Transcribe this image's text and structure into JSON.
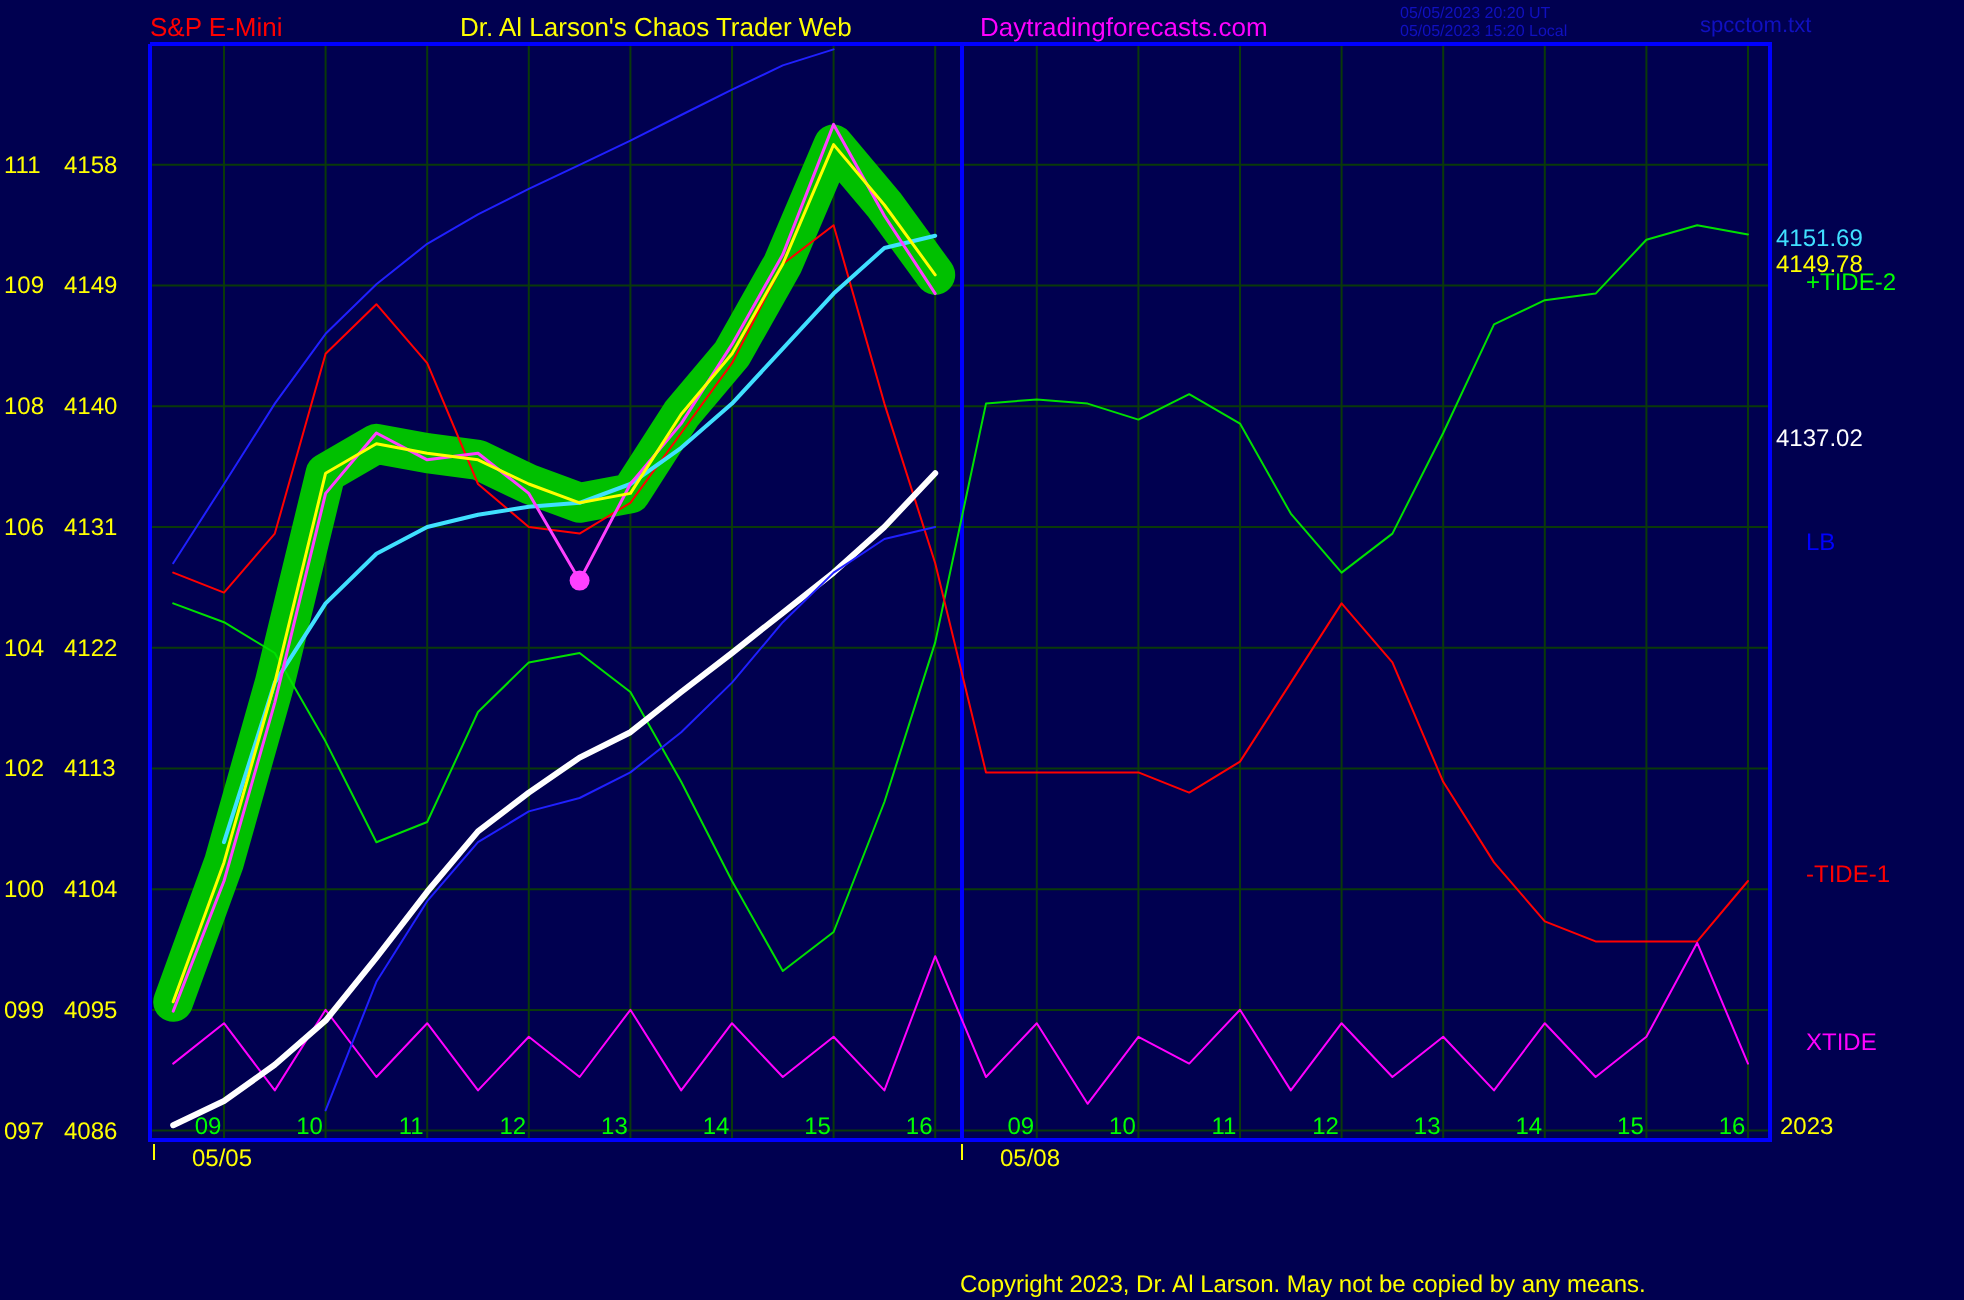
{
  "header": {
    "symbol": "S&P E-Mini",
    "title": "Dr. Al Larson's Chaos Trader Web",
    "site": "Daytradingforecasts.com",
    "time_ut": "05/05/2023 20:20 UT",
    "time_local": "05/05/2023 15:20 Local",
    "file": "spcctom.txt"
  },
  "scale_labels": [
    "111",
    "109",
    "108",
    "106",
    "104",
    "102",
    "100",
    "099",
    "097"
  ],
  "dates": [
    "05/05",
    "05/08"
  ],
  "year": "2023",
  "right_labels": [
    {
      "text": "4151.69",
      "color": "#40e0ff"
    },
    {
      "text": "4149.78",
      "color": "#ffff00"
    },
    {
      "text": "+TIDE-2",
      "color": "#00ff00"
    },
    {
      "text": "4137.02",
      "color": "#ffffff"
    },
    {
      "text": "LB",
      "color": "#0000ff"
    },
    {
      "text": "-TIDE-1",
      "color": "#ff0000"
    },
    {
      "text": "XTIDE",
      "color": "#ff00ff"
    }
  ],
  "chart_data": {
    "type": "line",
    "categories": [
      null,
      "09",
      null,
      "10",
      null,
      "11",
      null,
      "12",
      null,
      "13",
      null,
      "14",
      null,
      "15",
      null,
      "16",
      null,
      "09",
      null,
      "10",
      null,
      "11",
      null,
      "12",
      null,
      "13",
      null,
      "14",
      null,
      "15",
      null,
      "16"
    ],
    "yticks": [
      {
        "value": 4158,
        "label": "4158"
      },
      {
        "value": 4149,
        "label": "4149"
      },
      {
        "value": 4140,
        "label": "4140"
      },
      {
        "value": 4131,
        "label": "4131"
      },
      {
        "value": 4122,
        "label": "4122"
      },
      {
        "value": 4113,
        "label": "4113"
      },
      {
        "value": 4104,
        "label": "4104"
      },
      {
        "value": 4095,
        "label": "4095"
      },
      {
        "value": 4086,
        "label": "4086"
      }
    ],
    "ylim": [
      4085.3,
      4167
    ],
    "grid": true,
    "series": [
      {
        "color": "#00c000",
        "values": [
          4095.6,
          4106,
          4119.4,
          4135,
          4137.2,
          4136.5,
          4136,
          4134.2,
          4132.8,
          4133.5,
          4139.4,
          4143.9,
          4150.6,
          4159.5,
          4155,
          4149.8,
          null,
          null,
          null,
          null,
          null,
          null,
          null,
          null,
          null,
          null,
          null,
          null,
          null,
          null,
          null,
          null
        ]
      },
      {
        "color": "#2020ff",
        "values": [
          4128.3,
          4134.2,
          4140.2,
          4145.4,
          4149.1,
          4152.1,
          4154.3,
          4156.2,
          4158,
          4159.8,
          4161.7,
          4163.6,
          4165.4,
          4166.6,
          null,
          null,
          null,
          null,
          null,
          null,
          null,
          null,
          null,
          null,
          null,
          null,
          null,
          null,
          null,
          null,
          null,
          null
        ]
      },
      {
        "color": "#2020ff",
        "values": [
          null,
          null,
          null,
          4087.5,
          4097.1,
          4103.1,
          4107.5,
          4109.8,
          4110.8,
          4112.7,
          4115.7,
          4119.4,
          4123.9,
          4127.6,
          4130.1,
          4131,
          null,
          null,
          null,
          null,
          null,
          null,
          null,
          null,
          null,
          null,
          null,
          null,
          null,
          null,
          null,
          null
        ]
      },
      {
        "color": "#00e000",
        "values": [
          4125.3,
          4123.9,
          4121.6,
          4115,
          4107.5,
          4109,
          4117.2,
          4120.9,
          4121.6,
          4118.7,
          4112,
          4104.6,
          4097.9,
          4100.8,
          4110.5,
          4122.4,
          4140.2,
          4140.5,
          4140.2,
          4139,
          4140.9,
          4138.7,
          4132,
          4127.6,
          4130.5,
          4138,
          4146.1,
          4147.9,
          4148.4,
          4152.4,
          4153.5,
          4152.8
        ]
      },
      {
        "color": "#ff0000",
        "values": [
          4127.6,
          4126.1,
          4130.5,
          4143.9,
          4147.6,
          4143.2,
          4134.2,
          4131,
          4130.5,
          4132.8,
          4138,
          4143.2,
          4150.6,
          4153.5,
          4140.2,
          4128.3,
          4112.7,
          4112.7,
          4112.7,
          4112.7,
          4111.2,
          4113.5,
          4119.4,
          4125.3,
          4120.9,
          4112,
          4106,
          4101.6,
          4100.1,
          4100.1,
          4100.1,
          4104.6
        ]
      },
      {
        "color": "#ff00ff",
        "values": [
          4091,
          4094,
          4089,
          4095,
          4090,
          4094,
          4089,
          4093,
          4090,
          4095,
          4089,
          4094,
          4090,
          4093,
          4089,
          4099,
          4090,
          4094,
          4088,
          4093,
          4091,
          4095,
          4089,
          4094,
          4090,
          4093,
          4089,
          4094,
          4090,
          4093,
          4100,
          4091
        ]
      },
      {
        "color": "#ffffff",
        "values": [
          4086.4,
          4088.2,
          4090.9,
          4094.2,
          4098.9,
          4103.8,
          4108.3,
          4111.2,
          4113.8,
          4115.7,
          4118.7,
          4121.6,
          4124.6,
          4127.6,
          4131,
          4135,
          null,
          null,
          null,
          null,
          null,
          null,
          null,
          null,
          null,
          null,
          null,
          null,
          null,
          null,
          null,
          null
        ]
      },
      {
        "color": "#40e0ff",
        "values": [
          null,
          4107.5,
          4119.4,
          4125.3,
          4129,
          4131,
          4131.9,
          4132.5,
          4132.8,
          4134.2,
          4136.9,
          4140.2,
          4144.3,
          4148.4,
          4151.8,
          4152.7,
          null,
          null,
          null,
          null,
          null,
          null,
          null,
          null,
          null,
          null,
          null,
          null,
          null,
          null,
          null,
          null
        ]
      },
      {
        "color": "#ff40ff",
        "values": [
          4094.9,
          4104.6,
          4117.9,
          4133.5,
          4138,
          4136,
          4136.5,
          4133.5,
          4127,
          4134.2,
          4138.7,
          4144.6,
          4151.3,
          4161,
          4154.2,
          4148.4,
          null,
          null,
          null,
          null,
          null,
          null,
          null,
          null,
          null,
          null,
          null,
          null,
          null,
          null,
          null,
          null
        ]
      },
      {
        "color": "#ffff00",
        "values": [
          4095.6,
          4106,
          4119.4,
          4135,
          4137.2,
          4136.5,
          4136,
          4134.2,
          4132.8,
          4133.5,
          4139.4,
          4143.9,
          4150.6,
          4159.5,
          4155,
          4149.8,
          null,
          null,
          null,
          null,
          null,
          null,
          null,
          null,
          null,
          null,
          null,
          null,
          null,
          null,
          null,
          null
        ]
      }
    ]
  },
  "copyright": "Copyright 2023, Dr. Al Larson. May not be copied by any means."
}
